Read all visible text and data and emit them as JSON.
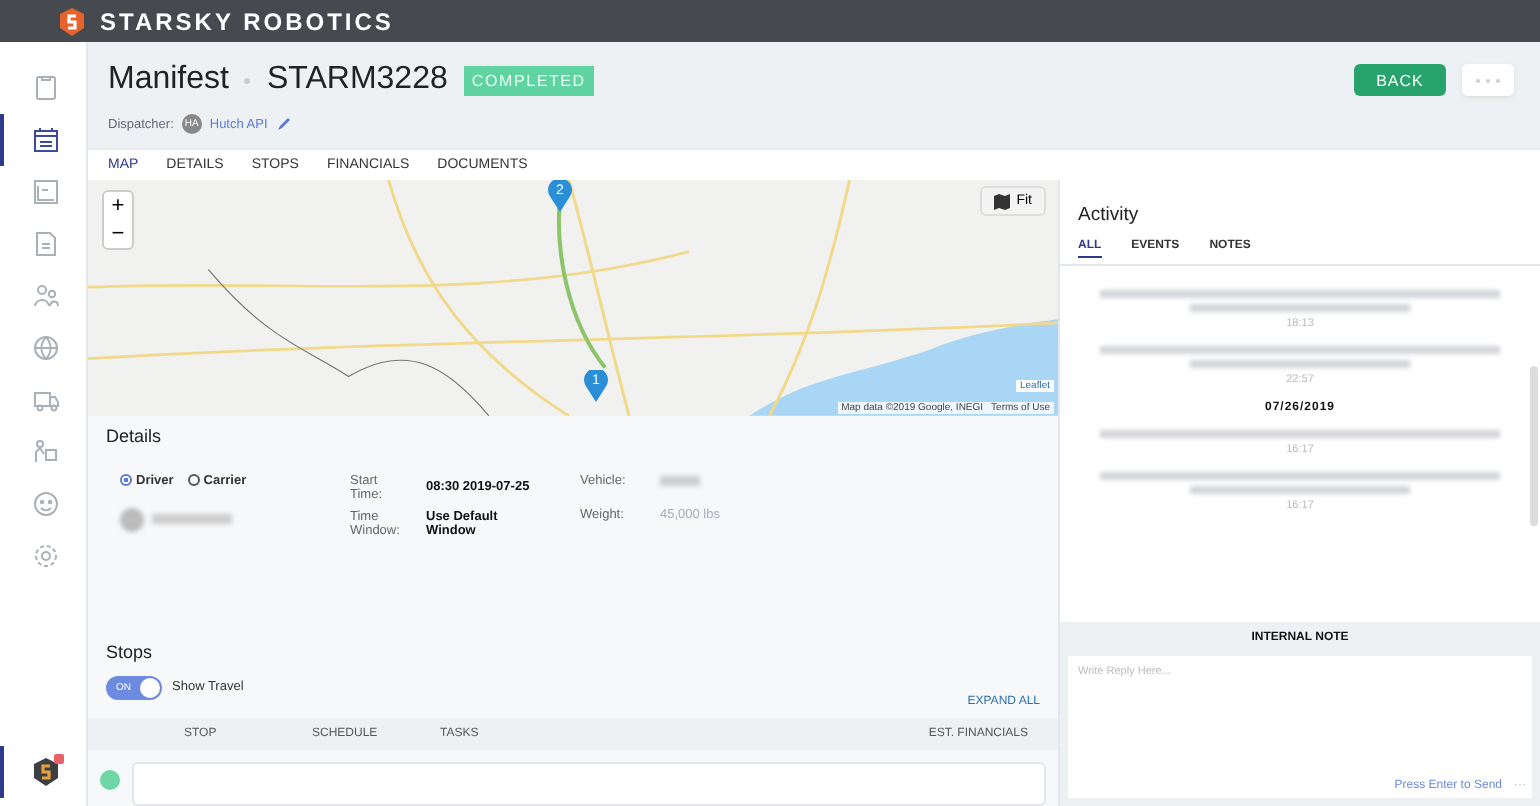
{
  "topbar": {
    "brand": "STARSKY ROBOTICS"
  },
  "sidebar": {
    "items": [
      {
        "selected": false
      },
      {
        "selected": true
      },
      {
        "selected": false
      },
      {
        "selected": false
      },
      {
        "selected": false
      },
      {
        "selected": false
      },
      {
        "selected": false
      },
      {
        "selected": false
      },
      {
        "selected": false
      },
      {
        "selected": false
      }
    ],
    "notification": true
  },
  "header": {
    "title": "Manifest",
    "id": "STARM3228",
    "status": "COMPLETED",
    "dispatcher_label": "Dispatcher:",
    "dispatcher_initials": "HA",
    "dispatcher": "Hutch API",
    "back": "BACK"
  },
  "tabs": [
    {
      "label": "MAP",
      "selected": true
    },
    {
      "label": "DETAILS",
      "selected": false
    },
    {
      "label": "STOPS",
      "selected": false
    },
    {
      "label": "FINANCIALS",
      "selected": false
    },
    {
      "label": "DOCUMENTS",
      "selected": false
    }
  ],
  "map": {
    "zoom_in": "+",
    "zoom_out": "−",
    "fit": "Fit",
    "pins": [
      "2",
      "1"
    ],
    "leaflet": "Leaflet",
    "attribution": "Map data ©2019 Google, INEGI",
    "terms": "Terms of Use"
  },
  "details": {
    "title": "Details",
    "assignees": [
      {
        "label": "Driver",
        "selected": true
      },
      {
        "label": "Carrier",
        "selected": false
      }
    ],
    "fields": [
      {
        "label": "Start Time:",
        "value": "08:30 2019-07-25"
      },
      {
        "label": "Time Window:",
        "value": "Use Default Window"
      }
    ],
    "vehicle_label": "Vehicle:",
    "weight_label": "Weight:",
    "weight": "45,000 lbs"
  },
  "stops": {
    "title": "Stops",
    "toggle": {
      "label": "ON",
      "on": true
    },
    "show_travel": "Show Travel",
    "expand_all": "EXPAND ALL",
    "columns": [
      "STOP",
      "SCHEDULE",
      "TASKS",
      "EST. FINANCIALS"
    ]
  },
  "activity": {
    "title": "Activity",
    "tabs": [
      {
        "label": "ALL",
        "selected": true
      },
      {
        "label": "EVENTS",
        "selected": false
      },
      {
        "label": "NOTES",
        "selected": false
      }
    ],
    "feed": [
      {
        "kind": "long_event",
        "time": "18:13"
      },
      {
        "kind": "long_event",
        "time": "22:57"
      },
      {
        "kind": "date",
        "text": "07/26/2019"
      },
      {
        "kind": "short_event",
        "time": "16:17"
      },
      {
        "kind": "long_event",
        "time": "16:17"
      }
    ],
    "note_title": "INTERNAL NOTE",
    "placeholder": "Write Reply Here...",
    "send_hint": "Press Enter to Send",
    "more": "···"
  }
}
